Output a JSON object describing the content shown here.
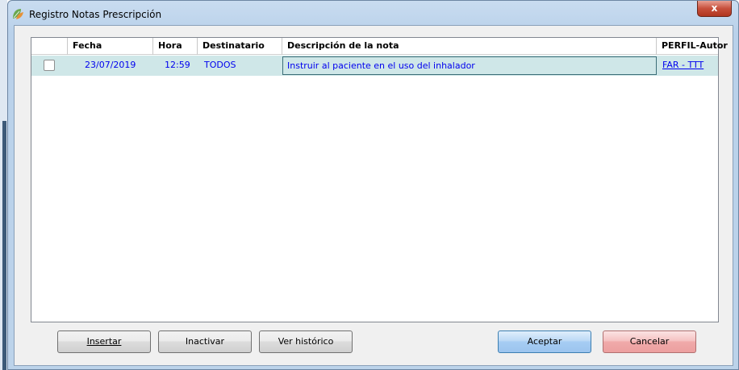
{
  "window": {
    "title": "Registro Notas Prescripción",
    "close_label": "x"
  },
  "grid": {
    "columns": [
      "Fecha",
      "Hora",
      "Destinatario",
      "Descripción de la nota",
      "PERFIL-Autor"
    ],
    "rows": [
      {
        "checked": false,
        "fecha": "23/07/2019",
        "hora": "12:59",
        "destinatario": "TODOS",
        "descripcion": "Instruir al paciente en el uso del inhalador",
        "autor": "FAR - TTT"
      }
    ]
  },
  "buttons": {
    "insert": "Insertar",
    "deactivate": "Inactivar",
    "history": "Ver histórico",
    "accept": "Aceptar",
    "cancel": "Cancelar"
  },
  "colors": {
    "selected_row": "#cfe7e8",
    "link_text": "#0000ee",
    "accept_button": "#a6cdf3",
    "cancel_button": "#f0aaaa"
  }
}
